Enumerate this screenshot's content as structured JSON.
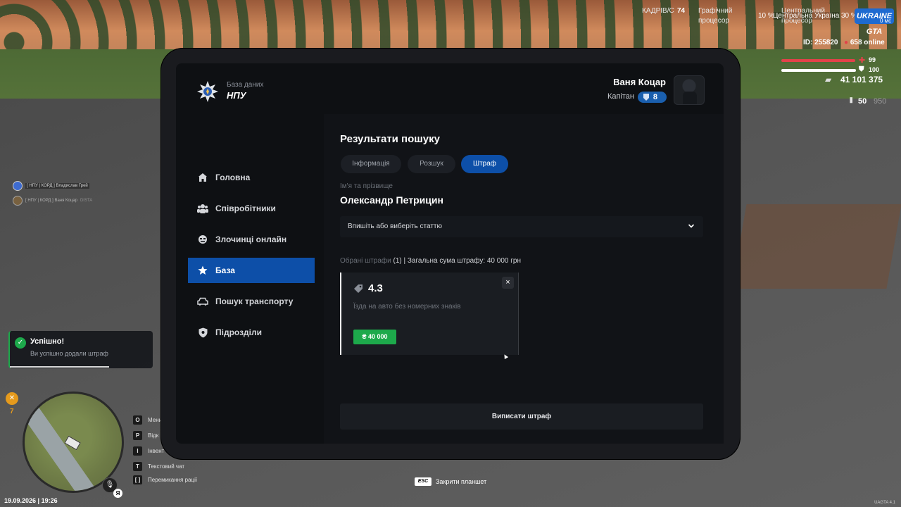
{
  "hud": {
    "fps_label": "КАДРІВ/С",
    "fps_value": "74",
    "gpu_label_1": "Графічний",
    "gpu_label_2": "процесор",
    "gpu_value": "10 %",
    "cpu_label_1": "Центральний",
    "cpu_label_2": "процесор",
    "cpu_value": "30 %",
    "ping_value": "0 мс",
    "server_name": "Центральна Україна",
    "logo_text": "UKRAINE GTA",
    "player_id": "ID: 255820",
    "online": "658 online",
    "health": "99",
    "armor": "100",
    "money": "41 101 375",
    "ammo_clip": "50",
    "ammo_total": "950",
    "health_fraction": 0.99,
    "armor_fraction": 1.0
  },
  "app": {
    "brand_sub": "База даних",
    "brand_name": "НПУ",
    "user_name": "Ваня Коцар",
    "user_rank": "Капітан",
    "user_level": "8"
  },
  "sidebar": {
    "items": [
      {
        "label": "Головна",
        "icon": "home-icon"
      },
      {
        "label": "Співробітники",
        "icon": "users-icon"
      },
      {
        "label": "Злочинці онлайн",
        "icon": "mask-icon"
      },
      {
        "label": "База",
        "icon": "star-icon",
        "active": true
      },
      {
        "label": "Пошук транспорту",
        "icon": "car-icon"
      },
      {
        "label": "Підрозділи",
        "icon": "shield-icon"
      }
    ]
  },
  "main": {
    "title": "Результати пошуку",
    "tabs": [
      {
        "label": "Інформація"
      },
      {
        "label": "Розшук"
      },
      {
        "label": "Штраф",
        "active": true
      }
    ],
    "name_label": "Ім'я та прізвище",
    "person_name": "Олександр Петрицин",
    "article_select": "Впишіть або виберіть статтю",
    "summary_label": "Обрані штрафи",
    "summary_count": "(1)",
    "summary_total": "| Загальна сума штрафу: 40 000 грн",
    "fine": {
      "code": "4.3",
      "description": "Їзда на авто без номерних знаків",
      "amount": "₴ 40 000",
      "close": "×"
    },
    "issue_button": "Виписати штраф"
  },
  "chat": {
    "line1": "[ НПУ | КОРД ] Владислав Грей",
    "line2": "[ НПУ | КОРД ] Ваня Коцар",
    "line2_tag": "DISTA"
  },
  "notification": {
    "title": "Успішно!",
    "text": "Ви успішно додали штраф",
    "icon": "check-icon"
  },
  "minimap_hud": {
    "skill_value": "7",
    "voice_lang": "Я"
  },
  "keys": [
    {
      "key": "O",
      "label": "Мени"
    },
    {
      "key": "P",
      "label": "Відк"
    },
    {
      "key": "I",
      "label": "Інвент"
    },
    {
      "key": "T",
      "label": "Текстовий чат"
    },
    {
      "key": "[ ]",
      "label": "Перемикання рації"
    }
  ],
  "footer": {
    "datetime": "19.09.2026 | 19:26",
    "esc_key": "ESC",
    "esc_label": "Закрити планшет",
    "version": "UAGTA 4.1"
  },
  "colors": {
    "accent": "#0d4fa8",
    "success": "#1da94b",
    "panel": "#0e1013"
  }
}
